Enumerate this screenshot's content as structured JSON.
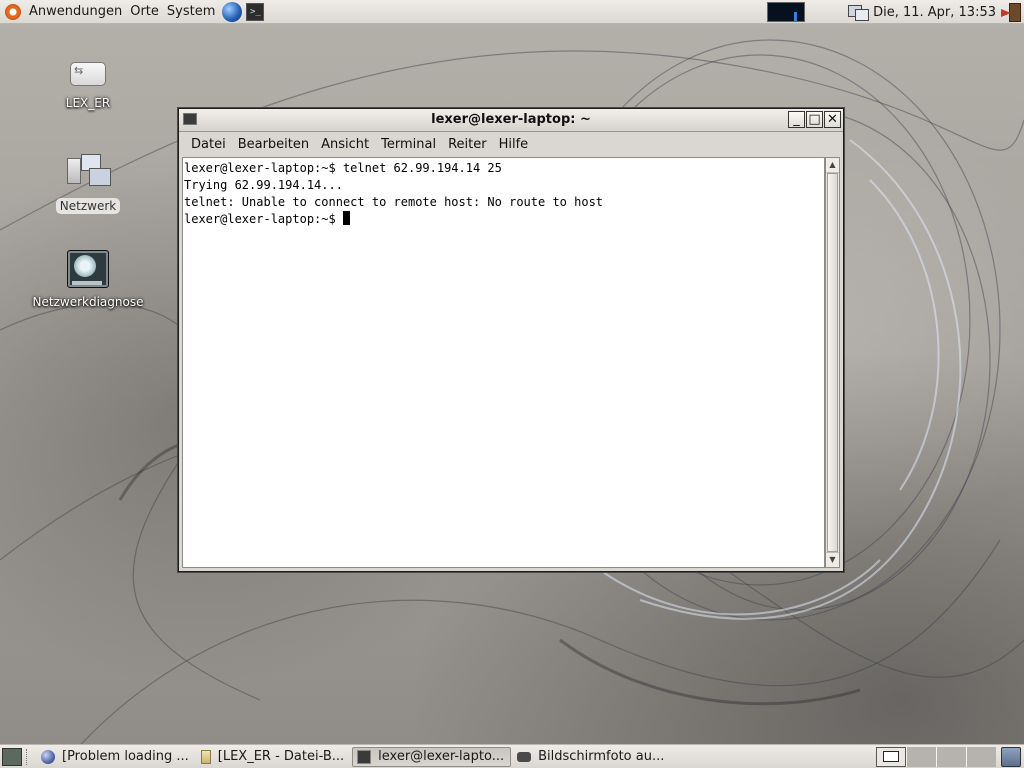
{
  "top_panel": {
    "menus": [
      "Anwendungen",
      "Orte",
      "System"
    ],
    "clock": "Die, 11. Apr, 13:53"
  },
  "desktop_icons": [
    {
      "label": "LEX_ER",
      "icon": "usb-drive-icon"
    },
    {
      "label": "Netzwerk",
      "icon": "network-icon",
      "selected": true
    },
    {
      "label": "Netzwerkdiagnose",
      "icon": "network-diagnosis-icon"
    }
  ],
  "terminal_window": {
    "title": "lexer@lexer-laptop: ~",
    "menu": [
      "Datei",
      "Bearbeiten",
      "Ansicht",
      "Terminal",
      "Reiter",
      "Hilfe"
    ],
    "lines": [
      "lexer@lexer-laptop:~$ telnet 62.99.194.14 25",
      "Trying 62.99.194.14...",
      "telnet: Unable to connect to remote host: No route to host",
      "lexer@lexer-laptop:~$ "
    ]
  },
  "taskbar": {
    "tasks": [
      {
        "label": "[Problem loading ...",
        "icon": "browser-icon",
        "active": false
      },
      {
        "label": "[LEX_ER - Datei-B...",
        "icon": "file-browser-icon",
        "active": false
      },
      {
        "label": "lexer@lexer-lapto...",
        "icon": "terminal-icon",
        "active": true
      },
      {
        "label": "Bildschirmfoto au...",
        "icon": "camera-icon",
        "active": false
      }
    ],
    "workspace_count": 4,
    "active_workspace": 1
  }
}
